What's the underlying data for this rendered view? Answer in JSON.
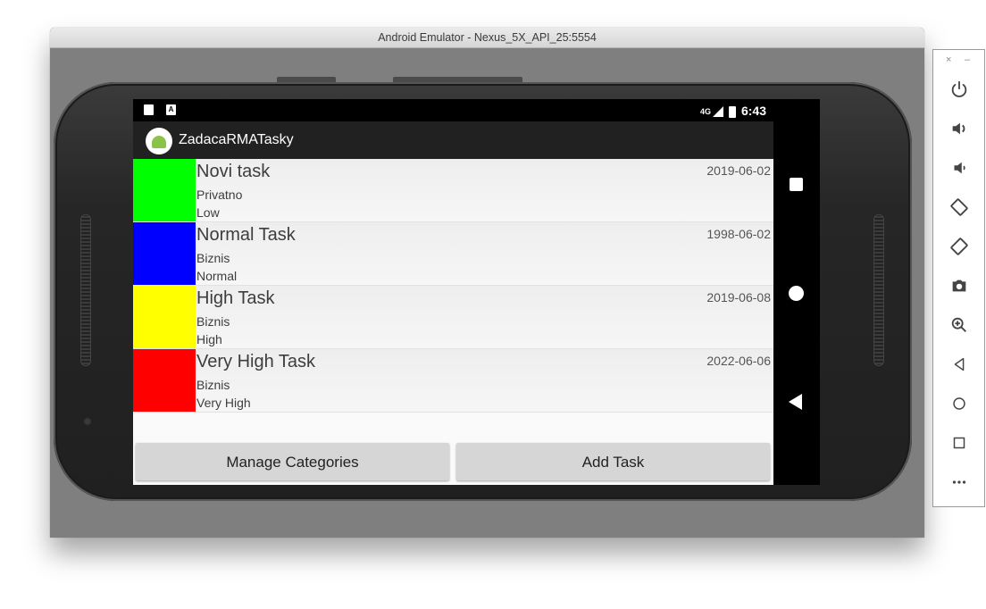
{
  "window": {
    "title": "Android Emulator - Nexus_5X_API_25:5554"
  },
  "statusbar": {
    "network": "4G",
    "time": "6:43",
    "keyboard_indicator": "A"
  },
  "app": {
    "title": "ZadacaRMATasky"
  },
  "tasks": [
    {
      "name": "Novi task",
      "category": "Privatno",
      "priority": "Low",
      "date": "2019-06-02",
      "color": "#00ff00"
    },
    {
      "name": "Normal Task",
      "category": "Biznis",
      "priority": "Normal",
      "date": "1998-06-02",
      "color": "#0000ff"
    },
    {
      "name": "High Task",
      "category": "Biznis",
      "priority": "High",
      "date": "2019-06-08",
      "color": "#ffff00"
    },
    {
      "name": "Very High Task",
      "category": "Biznis",
      "priority": "Very High",
      "date": "2022-06-06",
      "color": "#ff0000"
    }
  ],
  "buttons": {
    "manage_categories": "Manage Categories",
    "add_task": "Add Task"
  },
  "toolbar": {
    "close": "×",
    "minimize": "–",
    "icons": [
      "power-icon",
      "volume-up-icon",
      "volume-down-icon",
      "rotate-left-icon",
      "rotate-right-icon",
      "camera-icon",
      "zoom-icon",
      "back-icon",
      "home-icon",
      "overview-icon",
      "more-icon"
    ]
  }
}
